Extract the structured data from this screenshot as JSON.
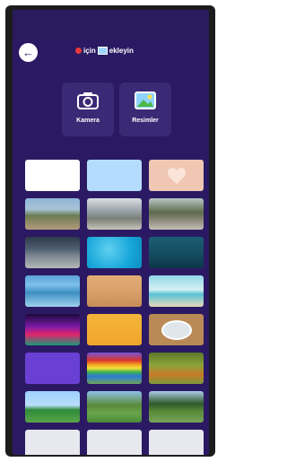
{
  "header": {
    "back_icon": "arrow-left-icon",
    "title_prefix": "için",
    "title_suffix": "ekleyin"
  },
  "sources": [
    {
      "label": "Kamera",
      "icon": "camera-icon"
    },
    {
      "label": "Resimler",
      "icon": "image-icon"
    }
  ],
  "backgrounds": [
    {
      "name": "bg-white",
      "cls": "t-white"
    },
    {
      "name": "bg-light-blue",
      "cls": "t-sky"
    },
    {
      "name": "bg-heart",
      "cls": "t-heart"
    },
    {
      "name": "bg-park-path",
      "cls": "t-park1"
    },
    {
      "name": "bg-park-building",
      "cls": "t-park2"
    },
    {
      "name": "bg-park-trees",
      "cls": "t-park3"
    },
    {
      "name": "bg-city-street",
      "cls": "t-city"
    },
    {
      "name": "bg-pool-water",
      "cls": "t-water"
    },
    {
      "name": "bg-underwater",
      "cls": "t-under"
    },
    {
      "name": "bg-ocean",
      "cls": "t-sea"
    },
    {
      "name": "bg-sand",
      "cls": "t-sand"
    },
    {
      "name": "bg-beach",
      "cls": "t-beach"
    },
    {
      "name": "bg-stage-lights",
      "cls": "t-stage"
    },
    {
      "name": "bg-yellow-room",
      "cls": "t-yellow"
    },
    {
      "name": "bg-wood-table",
      "cls": "t-wood"
    },
    {
      "name": "bg-purple",
      "cls": "t-purple"
    },
    {
      "name": "bg-rainbow",
      "cls": "t-rainbow"
    },
    {
      "name": "bg-meadow",
      "cls": "t-meadow"
    },
    {
      "name": "bg-field",
      "cls": "t-field1"
    },
    {
      "name": "bg-green-field",
      "cls": "t-field2"
    },
    {
      "name": "bg-forest-field",
      "cls": "t-field3"
    },
    {
      "name": "bg-partial-1",
      "cls": "t-partial"
    },
    {
      "name": "bg-partial-2",
      "cls": "t-partial"
    },
    {
      "name": "bg-partial-3",
      "cls": "t-partial"
    }
  ],
  "colors": {
    "background": "#2b1a63",
    "button": "#3a2a75",
    "accent": "#ffffff"
  }
}
